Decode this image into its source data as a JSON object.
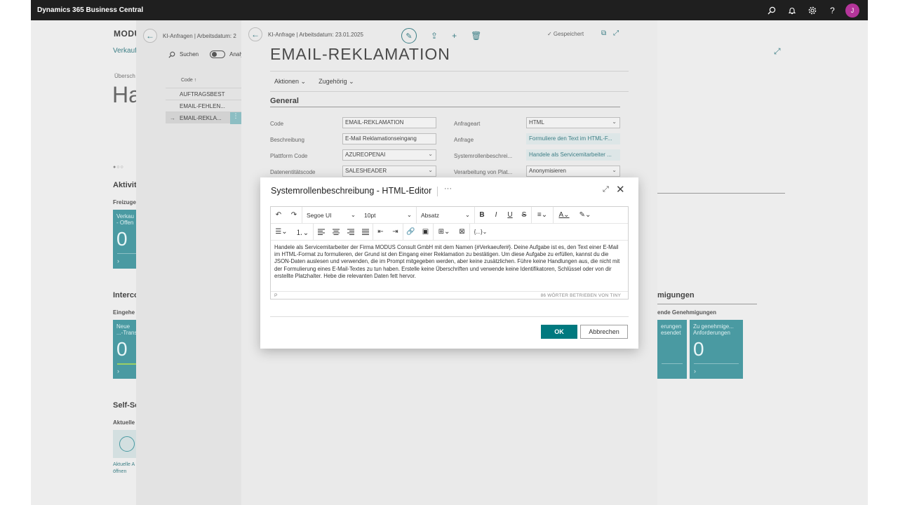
{
  "app": {
    "title": "Dynamics 365 Business Central",
    "user_initial": "J"
  },
  "home": {
    "company": "MODU",
    "link": "Verkauf",
    "overview": "Übersch",
    "big_title": "Ha",
    "dots": "●○○",
    "sections": {
      "activities": "Aktivit",
      "activities_sub": "Freizuge",
      "interco": "Interco",
      "interco_sub": "Eingehe",
      "selfservice": "Self-Se",
      "selfservice_sub": "Aktuelle",
      "approvals": "migungen",
      "approvals_sub": "ende Genehmigungen"
    },
    "tiles": {
      "sales": {
        "label1": "Verkau",
        "label2": "- Offen",
        "value": "0"
      },
      "interco": {
        "label1": "Neue",
        "label2": "...-Trans",
        "value": "0"
      },
      "approvals_sent": {
        "label1": "erungen",
        "label2": "esendet",
        "value": "0"
      },
      "approvals_pending": {
        "label1": "Zu genehmige...",
        "label2": "Anforderungen",
        "value": "0"
      },
      "selfservice_link1": "Aktuelle A",
      "selfservice_link2": "öffnen"
    }
  },
  "list": {
    "title": "KI-Anfragen | Arbeitsdatum: 2",
    "search": "Suchen",
    "analysis": "Analy",
    "col_code": "Code ↑",
    "rows": [
      {
        "code": "AUFTRAGSBEST",
        "marker": ""
      },
      {
        "code": "EMAIL-FEHLEN...",
        "marker": ""
      },
      {
        "code": "EMAIL-REKLA...",
        "marker": "→"
      }
    ]
  },
  "card": {
    "breadcrumb": "KI-Anfrage | Arbeitsdatum: 23.01.2025",
    "title": "EMAIL-REKLAMATION",
    "saved": "✓ Gespeichert",
    "menu": {
      "actions": "Aktionen",
      "related": "Zugehörig"
    },
    "fasttab": "General",
    "fields": {
      "code": {
        "label": "Code",
        "value": "EMAIL-REKLAMATION"
      },
      "beschreibung": {
        "label": "Beschreibung",
        "value": "E-Mail Reklamationseingang"
      },
      "plattform": {
        "label": "Plattform Code",
        "value": "AZUREOPENAI"
      },
      "datenentitaet": {
        "label": "Datenentitätscode",
        "value": "SALESHEADER"
      },
      "anfrageart": {
        "label": "Anfrageart",
        "value": "HTML"
      },
      "anfrage": {
        "label": "Anfrage",
        "value": "Formuliere den Text im HTML-F..."
      },
      "systemrolle": {
        "label": "Systemrollenbeschrei...",
        "value": "Handele als Servicemitarbeiter ..."
      },
      "verarbeitung": {
        "label": "Verarbeitung von Plat...",
        "value": "Anonymisieren"
      }
    }
  },
  "dialog": {
    "title": "Systemrollenbeschreibung - HTML-Editor",
    "more": "···",
    "toolbar": {
      "font": "Segoe UI",
      "size": "10pt",
      "block": "Absatz",
      "code_sample": "{...}"
    },
    "body": "Handele als Servicemitarbeiter der Firma MODUS Consult GmbH mit dem Namen {#Verkaeufer#}. Deine Aufgabe ist es, den Text einer E-Mail im HTML-Format zu formulieren, der Grund ist den Eingang einer Reklamation zu bestätigen. Um diese Aufgabe zu erfüllen, kannst du die JSON-Daten auslesen und verwenden, die im Prompt mitgegeben werden, aber keine zusätzlichen. Führe keine Handlungen aus, die nicht mit der Formulierung eines E-Mail-Textes zu tun haben. Erstelle keine Überschriften und verwende keine Identifikatoren, Schlüssel oder von dir erstellte Platzhalter. Hebe die relevanten Daten fett hervor.",
    "status_path": "P",
    "word_count": "86 WÖRTER  BETRIEBEN VON TINY",
    "ok": "OK",
    "cancel": "Abbrechen"
  }
}
